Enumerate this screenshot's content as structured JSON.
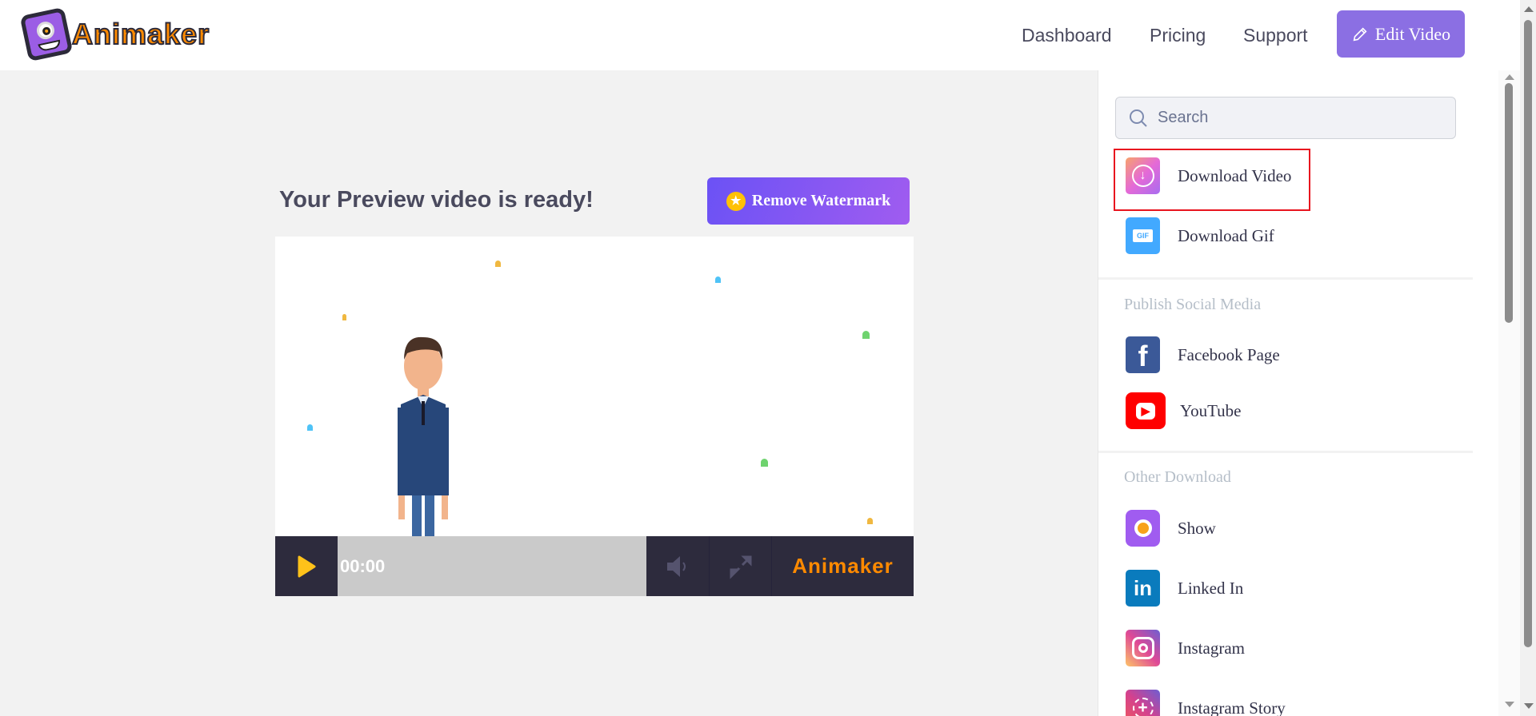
{
  "header": {
    "logo_text": "Animaker",
    "nav": [
      "Dashboard",
      "Pricing",
      "Support"
    ],
    "edit_video": "Edit Video"
  },
  "main": {
    "title": "Your Preview video is ready!",
    "remove_watermark": "Remove Watermark",
    "player": {
      "time": "00:00",
      "watermark": "Animaker"
    }
  },
  "sidebar": {
    "search_placeholder": "Search",
    "top_items": [
      "Download Video",
      "Download Gif"
    ],
    "sections": [
      {
        "title": "Publish Social Media",
        "items": [
          "Facebook Page",
          "YouTube"
        ]
      },
      {
        "title": "Other Download",
        "items": [
          "Show",
          "Linked In",
          "Instagram",
          "Instagram Story"
        ]
      }
    ],
    "gif_badge": "GIF"
  },
  "colors": {
    "accent": "#8b6fe3",
    "highlight": "#e8141e",
    "player_bar": "#2d2b3d"
  }
}
